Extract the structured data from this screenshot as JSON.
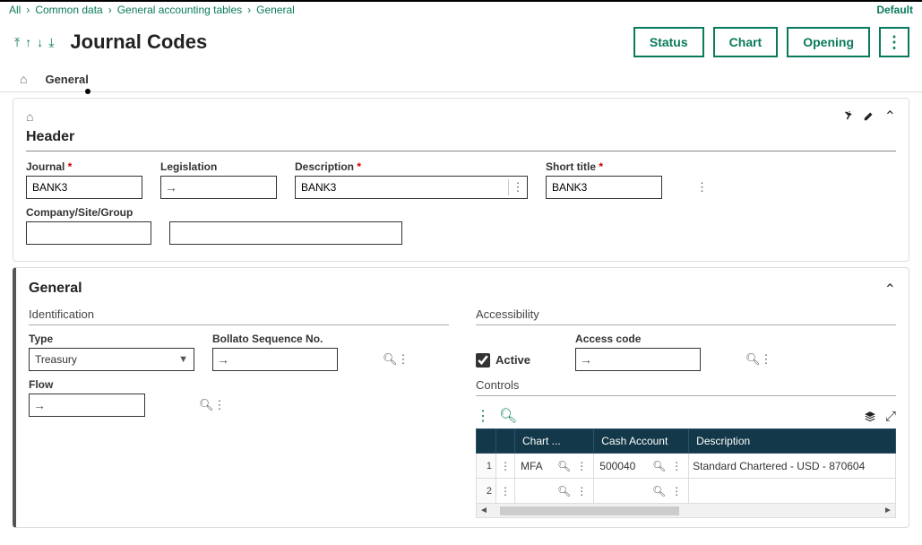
{
  "breadcrumb": {
    "all": "All",
    "common": "Common data",
    "tables": "General accounting tables",
    "general": "General",
    "default": "Default"
  },
  "title": "Journal Codes",
  "buttons": {
    "status": "Status",
    "chart": "Chart",
    "opening": "Opening"
  },
  "tabs": {
    "general": "General"
  },
  "header": {
    "title": "Header",
    "journal_label": "Journal",
    "journal_value": "BANK3",
    "legislation_label": "Legislation",
    "legislation_value": "",
    "description_label": "Description",
    "description_value": "BANK3",
    "shorttitle_label": "Short title",
    "shorttitle_value": "BANK3",
    "csg_label": "Company/Site/Group",
    "csg_value": "",
    "csg_text": ""
  },
  "general": {
    "title": "General",
    "identification_label": "Identification",
    "type_label": "Type",
    "type_value": "Treasury",
    "bollato_label": "Bollato Sequence No.",
    "bollato_value": "",
    "flow_label": "Flow",
    "flow_value": "",
    "accessibility_label": "Accessibility",
    "active_label": "Active",
    "active_checked": true,
    "access_label": "Access code",
    "access_value": "",
    "controls_label": "Controls",
    "grid": {
      "headers": {
        "chart": "Chart ...",
        "cash": "Cash Account",
        "desc": "Description"
      },
      "rows": [
        {
          "num": "1",
          "chart": "MFA",
          "cash": "500040",
          "desc": "Standard Chartered - USD - 870604"
        },
        {
          "num": "2",
          "chart": "",
          "cash": "",
          "desc": ""
        }
      ]
    }
  }
}
